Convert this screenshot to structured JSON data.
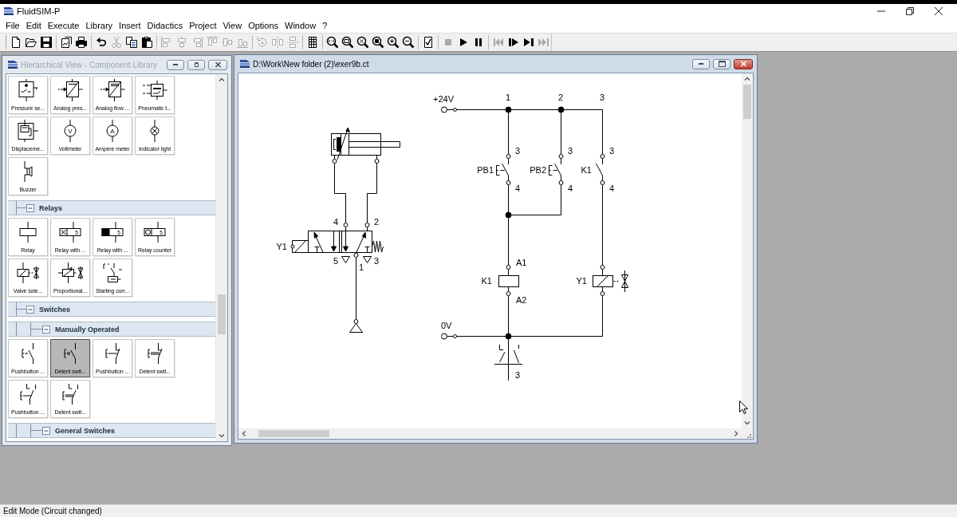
{
  "app_window": {
    "title": "FluidSIM-P"
  },
  "menu_bar": [
    "File",
    "Edit",
    "Execute",
    "Library",
    "Insert",
    "Didactics",
    "Project",
    "View",
    "Options",
    "Window",
    "?"
  ],
  "toolbar": {
    "groups": [
      {
        "buttons": [
          {
            "kind": "new",
            "disabled": false
          },
          {
            "kind": "open",
            "disabled": false
          },
          {
            "kind": "save",
            "disabled": false
          }
        ]
      },
      {
        "buttons": [
          {
            "kind": "export",
            "disabled": false
          },
          {
            "kind": "print",
            "disabled": false
          }
        ]
      },
      {
        "buttons": [
          {
            "kind": "undo",
            "disabled": false
          },
          {
            "kind": "cut",
            "disabled": true
          },
          {
            "kind": "copy",
            "disabled": false
          },
          {
            "kind": "paste",
            "disabled": false
          }
        ]
      },
      {
        "buttons": [
          {
            "kind": "alignleft",
            "disabled": true
          },
          {
            "kind": "aligncenter",
            "disabled": true
          },
          {
            "kind": "alignright",
            "disabled": true
          },
          {
            "kind": "aligntop",
            "disabled": true
          },
          {
            "kind": "alignmiddle",
            "disabled": true
          },
          {
            "kind": "alignbottom",
            "disabled": true
          }
        ]
      },
      {
        "buttons": [
          {
            "kind": "rotate",
            "disabled": true
          },
          {
            "kind": "fliphorizontal",
            "disabled": true
          },
          {
            "kind": "flipvertical",
            "disabled": true
          }
        ]
      },
      {
        "buttons": [
          {
            "kind": "grid",
            "disabled": false
          }
        ]
      },
      {
        "buttons": [
          {
            "kind": "zoomreset",
            "disabled": false
          },
          {
            "kind": "zoomwindow",
            "disabled": false
          },
          {
            "kind": "zoomfit",
            "disabled": false
          },
          {
            "kind": "zoomprevious",
            "disabled": false
          },
          {
            "kind": "zoomin",
            "disabled": false
          },
          {
            "kind": "zoomout",
            "disabled": false
          }
        ]
      },
      {
        "buttons": [
          {
            "kind": "check",
            "disabled": false
          }
        ]
      },
      {
        "buttons": [
          {
            "kind": "stop",
            "disabled": true
          },
          {
            "kind": "play",
            "disabled": false
          },
          {
            "kind": "pause",
            "disabled": false
          }
        ]
      },
      {
        "buttons": [
          {
            "kind": "reset",
            "disabled": true
          },
          {
            "kind": "step",
            "disabled": false
          },
          {
            "kind": "steptoend",
            "disabled": false
          },
          {
            "kind": "fastforward",
            "disabled": true
          }
        ]
      }
    ]
  },
  "library_window": {
    "title": "Hierarchical View - Component Library",
    "active": false,
    "tree": [
      {
        "kind": "tiles",
        "tiles": [
          {
            "label": "Pressure se...",
            "kind": "pressureswitch",
            "selected": false
          },
          {
            "label": "Analog pres...",
            "kind": "pressureconverter",
            "selected": false
          },
          {
            "label": "Analog flow ...",
            "kind": "flowconverter",
            "selected": false
          },
          {
            "label": "Pneumatic t...",
            "kind": "pneumaticconverter",
            "selected": false
          },
          {
            "label": "Displaceme...",
            "kind": "encoder",
            "selected": false
          },
          {
            "label": "Voltmeter",
            "kind": "meter",
            "glyph": "V",
            "selected": false
          },
          {
            "label": "Ampere meter",
            "kind": "meter",
            "glyph": "A",
            "selected": false
          },
          {
            "label": "Indicator light",
            "kind": "lamp",
            "selected": false
          },
          {
            "label": "Buzzer",
            "kind": "buzzer",
            "selected": false
          }
        ]
      },
      {
        "kind": "group",
        "label": "Relays",
        "expanded": true,
        "children": [
          {
            "kind": "tiles",
            "tiles": [
              {
                "label": "Relay",
                "kind": "relay",
                "selected": false
              },
              {
                "label": "Relay with ...",
                "kind": "ondelayrelay",
                "glyph": "5",
                "selected": false
              },
              {
                "label": "Relay with ...",
                "kind": "offdelayrelay",
                "glyph": "5",
                "selected": false
              },
              {
                "label": "Relay counter",
                "kind": "counterrelay",
                "glyph": "5",
                "selected": false
              },
              {
                "label": "Valve sole...",
                "kind": "valvesolenoid",
                "selected": false
              },
              {
                "label": "Proportional...",
                "kind": "proportionalsolenoid",
                "selected": false
              },
              {
                "label": "Starting curr...",
                "kind": "startingcurrent",
                "selected": false
              }
            ]
          }
        ]
      },
      {
        "kind": "group",
        "label": "Switches",
        "expanded": true,
        "children": [
          {
            "kind": "group",
            "label": "Manually Operated",
            "expanded": true,
            "children": [
              {
                "kind": "tiles",
                "tiles": [
                  {
                    "label": "Pushbutton ...",
                    "kind": "pushbuttonno",
                    "selected": false
                  },
                  {
                    "label": "Detent swit...",
                    "kind": "detentno",
                    "selected": true
                  },
                  {
                    "label": "Pushbutton ...",
                    "kind": "pushbuttonnc",
                    "selected": false
                  },
                  {
                    "label": "Detent swit...",
                    "kind": "detentnc",
                    "selected": false
                  },
                  {
                    "label": "Pushbutton ...",
                    "kind": "pushbuttonco",
                    "selected": false
                  },
                  {
                    "label": "Detent swit...",
                    "kind": "detentco",
                    "selected": false
                  }
                ]
              }
            ]
          },
          {
            "kind": "group",
            "label": "General Switches",
            "expanded": true
          }
        ]
      }
    ]
  },
  "circuit_window": {
    "title": "D:\\Work\\New folder (2)\\exer9b.ct",
    "active": true,
    "pneumatic": {
      "valve_solenoid": "Y1",
      "port_labels": [
        "4",
        "2",
        "5",
        "3",
        "1"
      ]
    },
    "electrical": {
      "supply": "+24V",
      "ground": "0V",
      "rungs": [
        {
          "number": "1",
          "contact": {
            "kind": "pushbutton",
            "label": "PB1",
            "terminals": [
              "3",
              "4"
            ]
          },
          "coil": {
            "kind": "relay",
            "label": "K1",
            "terminals": [
              "A1",
              "A2"
            ]
          }
        },
        {
          "number": "2",
          "contact": {
            "kind": "pushbutton",
            "label": "PB2",
            "terminals": [
              "3",
              "4"
            ]
          }
        },
        {
          "number": "3",
          "contact": {
            "kind": "relay",
            "label": "K1",
            "terminals": [
              "3",
              "4"
            ]
          },
          "coil": {
            "kind": "solenoid",
            "label": "Y1"
          }
        }
      ],
      "contact_table": [
        "3"
      ]
    }
  },
  "status_bar": "Edit Mode (Circuit changed)"
}
